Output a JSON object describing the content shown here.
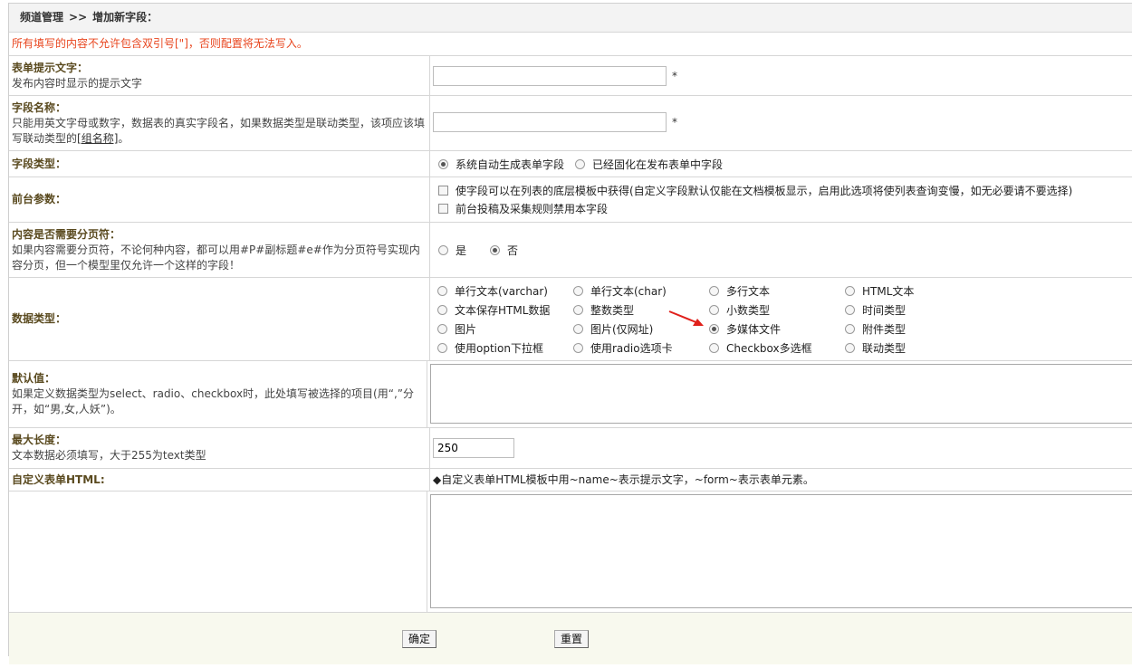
{
  "breadcrumb": {
    "section": "频道管理",
    "separator": ">>",
    "page": "增加新字段："
  },
  "warning": "所有填写的内容不允许包含双引号[\"]，否则配置将无法写入。",
  "fields": {
    "hint_text": {
      "label": "表单提示文字：",
      "desc": "发布内容时显示的提示文字",
      "value": "",
      "required": "*"
    },
    "field_name": {
      "label": "字段名称：",
      "desc_part1": "只能用英文字母或数字，数据表的真实字段名，如果数据类型是联动类型，该项应该填写联动类型的",
      "desc_link": "[组名称]",
      "desc_part2": "。",
      "value": "",
      "required": "*"
    },
    "field_type": {
      "label": "字段类型：",
      "options": [
        "系统自动生成表单字段",
        "已经固化在发布表单中字段"
      ],
      "selected": 0
    },
    "frontend": {
      "label": "前台参数：",
      "checks": [
        "使字段可以在列表的底层模板中获得(自定义字段默认仅能在文档模板显示，启用此选项将使列表查询变慢，如无必要请不要选择)",
        "前台投稿及采集规则禁用本字段"
      ]
    },
    "paging": {
      "label": "内容是否需要分页符：",
      "desc": "如果内容需要分页符，不论何种内容，都可以用#P#副标题#e#作为分页符号实现内容分页，但一个模型里仅允许一个这样的字段！",
      "options": [
        "是",
        "否"
      ],
      "selected": 1
    },
    "data_type": {
      "label": "数据类型：",
      "options": [
        "单行文本(varchar)",
        "单行文本(char)",
        "多行文本",
        "HTML文本",
        "文本保存HTML数据",
        "整数类型",
        "小数类型",
        "时间类型",
        "图片",
        "图片(仅网址)",
        "多媒体文件",
        "附件类型",
        "使用option下拉框",
        "使用radio选项卡",
        "Checkbox多选框",
        "联动类型"
      ],
      "selected": 10
    },
    "default_value": {
      "label": "默认值：",
      "desc": "如果定义数据类型为select、radio、checkbox时，此处填写被选择的项目(用“,”分开，如“男,女,人妖”)。",
      "value": ""
    },
    "max_length": {
      "label": "最大长度：",
      "desc": "文本数据必须填写，大于255为text类型",
      "value": "250"
    },
    "custom_html": {
      "label": "自定义表单HTML:",
      "note": "◆自定义表单HTML模板中用~name~表示提示文字，~form~表示表单元素。",
      "value": ""
    }
  },
  "buttons": {
    "confirm": "确定",
    "reset": "重置"
  },
  "colors": {
    "label": "#5a4a1f",
    "warning": "#e8451e",
    "arrow": "#e0201b",
    "footer_bg": "#f8f9ee"
  }
}
